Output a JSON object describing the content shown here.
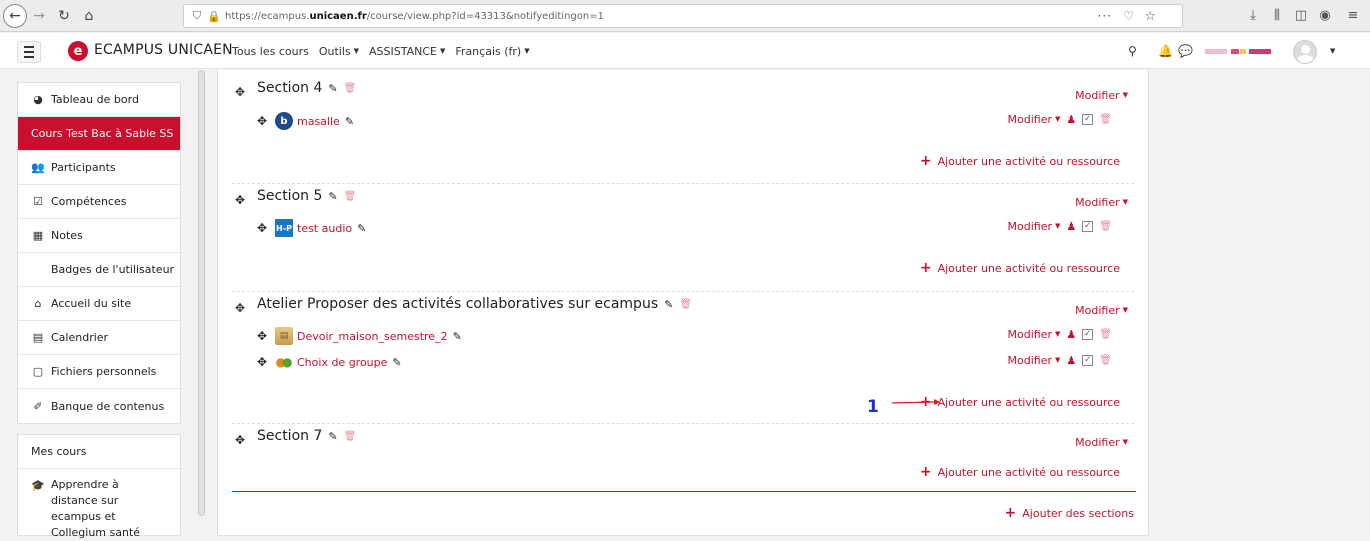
{
  "browser": {
    "url_prefix": "https://ecampus.",
    "url_domain": "unicaen.fr",
    "url_rest": "/course/view.php?id=43313&notifyeditingon=1",
    "more_icon": "···",
    "icons": [
      "back-icon",
      "forward-icon",
      "reload-icon",
      "home-icon",
      "shield-icon",
      "lock-icon",
      "pocket-icon",
      "star-icon",
      "download-icon",
      "library-icon",
      "sidebar-icon",
      "account-icon",
      "menu-icon"
    ]
  },
  "navbar": {
    "logo_letter": "e",
    "brand": "ECAMPUS UNICAEN",
    "menu": [
      "Tous les cours",
      "Outils",
      "ASSISTANCE",
      "Français (fr)"
    ],
    "brand_color": "#c8102e"
  },
  "drawer": {
    "items": [
      {
        "icon": "dashboard-icon",
        "glyph": "◕",
        "label": "Tableau de bord"
      },
      {
        "icon": "",
        "glyph": "",
        "label": "Cours Test Bac à Sable SS",
        "active": true
      },
      {
        "icon": "participants-icon",
        "glyph": "👥",
        "label": "Participants"
      },
      {
        "icon": "checkbox-icon",
        "glyph": "☑",
        "label": "Compétences"
      },
      {
        "icon": "table-icon",
        "glyph": "▦",
        "label": "Notes"
      },
      {
        "icon": "",
        "glyph": "",
        "label": "Badges de l'utilisateur"
      },
      {
        "icon": "home-icon",
        "glyph": "⌂",
        "label": "Accueil du site"
      },
      {
        "icon": "calendar-icon",
        "glyph": "▤",
        "label": "Calendrier"
      },
      {
        "icon": "file-icon",
        "glyph": "▢",
        "label": "Fichiers personnels"
      },
      {
        "icon": "brush-icon",
        "glyph": "✐",
        "label": "Banque de contenus"
      }
    ],
    "mes_cours_title": "Mes cours",
    "mes_cours_item": "Apprendre à distance sur ecampus et Collegium santé"
  },
  "course": {
    "modifier_label": "Modifier",
    "add_activity_label": "Ajouter une activité ou ressource",
    "add_sections_label": "Ajouter des sections",
    "sections": [
      {
        "title": "Section 4",
        "activities": [
          {
            "name": "masalle",
            "icon": "bigbluebutton-icon"
          }
        ]
      },
      {
        "title": "Section 5",
        "activities": [
          {
            "name": "test audio",
            "icon": "h5p-icon"
          }
        ]
      },
      {
        "title": "Atelier Proposer des activités collaboratives sur ecampus",
        "activities": [
          {
            "name": "Devoir_maison_semestre_2",
            "icon": "assignment-icon"
          },
          {
            "name": "Choix de groupe",
            "icon": "group-choice-icon"
          }
        ]
      },
      {
        "title": "Section 7",
        "activities": []
      }
    ],
    "annotation_number": "1",
    "annotation_color": "#1f2fd6"
  }
}
